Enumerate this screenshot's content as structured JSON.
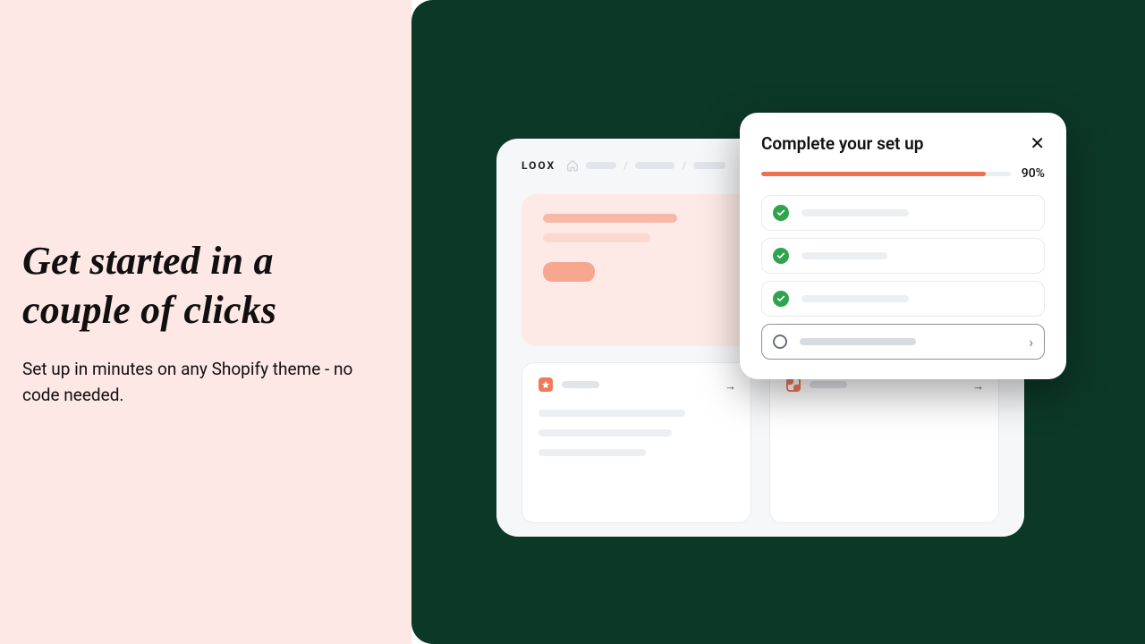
{
  "left": {
    "headline": "Get started in a couple of clicks",
    "subhead": "Set up in minutes on any Shopify theme - no code needed."
  },
  "app": {
    "logo": "LOOX"
  },
  "popup": {
    "title": "Complete your set up",
    "progress_pct": 90,
    "progress_label": "90%",
    "steps": [
      {
        "done": true
      },
      {
        "done": true
      },
      {
        "done": true
      },
      {
        "done": false
      }
    ]
  },
  "colors": {
    "left_bg": "#fde8e5",
    "right_bg": "#0c3828",
    "accent": "#ef704e",
    "success": "#2ea44f"
  }
}
